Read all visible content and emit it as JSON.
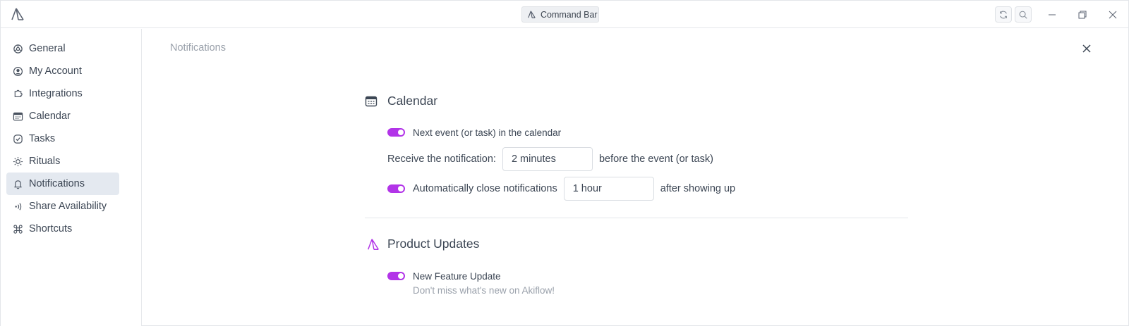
{
  "titlebar": {
    "command_bar_label": "Command Bar"
  },
  "sidebar": {
    "items": [
      {
        "label": "General",
        "icon": "gear-icon"
      },
      {
        "label": "My Account",
        "icon": "user-circle-icon"
      },
      {
        "label": "Integrations",
        "icon": "puzzle-icon"
      },
      {
        "label": "Calendar",
        "icon": "calendar-icon"
      },
      {
        "label": "Tasks",
        "icon": "check-circle-icon"
      },
      {
        "label": "Rituals",
        "icon": "sun-icon"
      },
      {
        "label": "Notifications",
        "icon": "bell-icon"
      },
      {
        "label": "Share Availability",
        "icon": "broadcast-icon"
      },
      {
        "label": "Shortcuts",
        "icon": "command-icon"
      }
    ],
    "active": "Notifications"
  },
  "main": {
    "page_title": "Notifications",
    "calendar": {
      "title": "Calendar",
      "next_event_label": "Next event (or task) in the calendar",
      "next_event_enabled": true,
      "receive_label": "Receive the notification:",
      "receive_value": "2 minutes",
      "receive_suffix": "before the event (or task)",
      "auto_close_label": "Automatically close notifications",
      "auto_close_enabled": true,
      "auto_close_value": "1 hour",
      "auto_close_suffix": "after showing up"
    },
    "product_updates": {
      "title": "Product Updates",
      "feature_label": "New Feature Update",
      "feature_enabled": true,
      "feature_description": "Don't miss what's new on Akiflow!"
    }
  },
  "colors": {
    "accent": "#b234e8",
    "active_nav_bg": "#e4e9f0",
    "text": "#3c4654",
    "muted_text": "#9aa1ab"
  }
}
